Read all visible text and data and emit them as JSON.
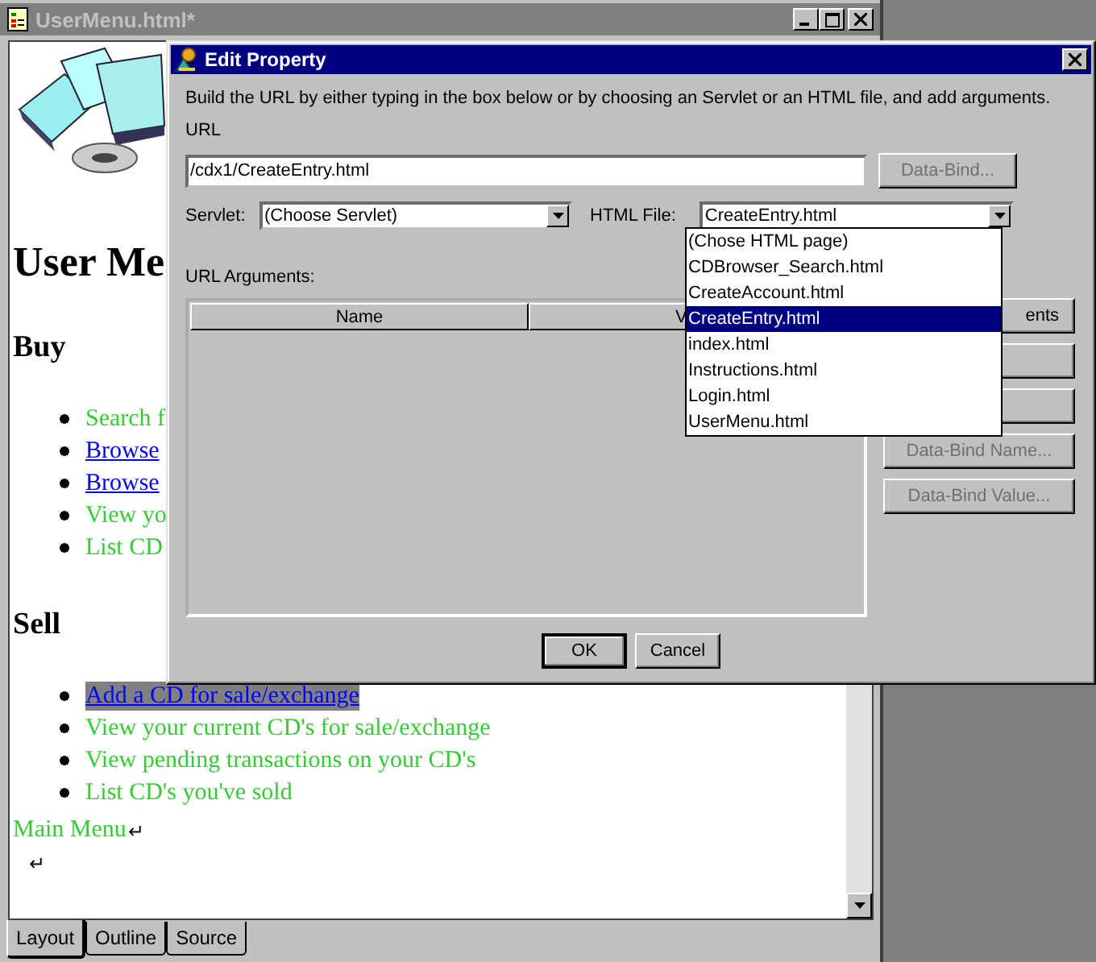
{
  "editor": {
    "title": "UserMenu.html*",
    "heading": "User Me",
    "sections": [
      {
        "heading": "Buy",
        "items": [
          {
            "text": "Search f",
            "kind": "plain",
            "selected": false
          },
          {
            "text": "Browse",
            "kind": "link",
            "selected": false
          },
          {
            "text": "Browse",
            "kind": "link",
            "selected": false
          },
          {
            "text": "View yo",
            "kind": "plain",
            "selected": false
          },
          {
            "text": "List CD",
            "kind": "plain",
            "selected": false
          }
        ]
      },
      {
        "heading": "Sell",
        "items": [
          {
            "text": "Add a CD for sale/exchange",
            "kind": "link",
            "selected": true
          },
          {
            "text": "View your current CD's for sale/exchange",
            "kind": "plain",
            "selected": false
          },
          {
            "text": "View pending transactions on your CD's",
            "kind": "plain",
            "selected": false
          },
          {
            "text": "List CD's you've sold",
            "kind": "plain",
            "selected": false
          }
        ]
      }
    ],
    "footer": "Main Menu",
    "footer_mark": "↵",
    "blank_lines": [
      "↵"
    ],
    "tabs": [
      {
        "label": "Layout",
        "selected": true
      },
      {
        "label": "Outline",
        "selected": false
      },
      {
        "label": "Source",
        "selected": false
      }
    ]
  },
  "dialog": {
    "title": "Edit Property",
    "instructions": "Build the URL by either typing in the box below or by choosing an Servlet or an HTML file, and add arguments.",
    "url_label": "URL",
    "url_value": "/cdx1/CreateEntry.html",
    "data_bind_button": {
      "label": "Data-Bind...",
      "disabled": true
    },
    "servlet": {
      "label": "Servlet:",
      "value": "(Choose Servlet)"
    },
    "html_file": {
      "label": "HTML File:",
      "value": "CreateEntry.html",
      "expanded": true,
      "options": [
        {
          "label": "(Chose HTML page)",
          "selected": false
        },
        {
          "label": "CDBrowser_Search.html",
          "selected": false
        },
        {
          "label": "CreateAccount.html",
          "selected": false
        },
        {
          "label": "CreateEntry.html",
          "selected": true
        },
        {
          "label": "index.html",
          "selected": false
        },
        {
          "label": "Instructions.html",
          "selected": false
        },
        {
          "label": "Login.html",
          "selected": false
        },
        {
          "label": "UserMenu.html",
          "selected": false
        }
      ]
    },
    "arguments": {
      "label": "URL Arguments:",
      "columns": [
        "Name",
        "V"
      ]
    },
    "side_buttons": [
      {
        "label": "ents",
        "disabled": false
      },
      {
        "disabled": false
      },
      {
        "disabled": false
      },
      {
        "label": "Data-Bind Name...",
        "disabled": true
      },
      {
        "label": "Data-Bind Value...",
        "disabled": true
      }
    ],
    "buttons": [
      {
        "label": "OK",
        "default": true
      },
      {
        "label": "Cancel",
        "default": false
      }
    ]
  }
}
